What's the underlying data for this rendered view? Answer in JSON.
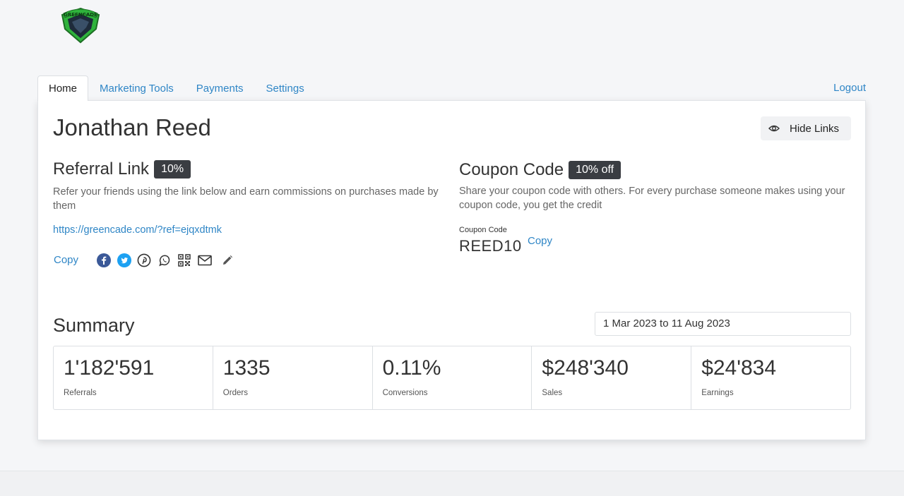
{
  "brand": {
    "logo_text": "GREENCADE",
    "logo_color": "#2fb33c"
  },
  "tabs": [
    {
      "label": "Home",
      "active": true
    },
    {
      "label": "Marketing Tools",
      "active": false
    },
    {
      "label": "Payments",
      "active": false
    },
    {
      "label": "Settings",
      "active": false
    }
  ],
  "logout_label": "Logout",
  "user_name": "Jonathan Reed",
  "hide_links_label": "Hide Links",
  "referral": {
    "title": "Referral Link",
    "badge": "10%",
    "description": "Refer your friends using the link below and earn commissions on purchases made by them",
    "link": "https://greencade.com/?ref=ejqxdtmk",
    "copy_label": "Copy",
    "share_icons": [
      "facebook-icon",
      "twitter-icon",
      "pinterest-icon",
      "whatsapp-icon",
      "qr-code-icon",
      "email-icon",
      "edit-icon"
    ]
  },
  "coupon": {
    "title": "Coupon Code",
    "badge": "10% off",
    "description": "Share your coupon code with others. For every purchase someone makes using your coupon code, you get the credit",
    "field_label": "Coupon Code",
    "code": "REED10",
    "copy_label": "Copy"
  },
  "summary": {
    "title": "Summary",
    "date_range": "1 Mar 2023 to 11 Aug 2023",
    "stats": [
      {
        "value": "1'182'591",
        "label": "Referrals"
      },
      {
        "value": "1335",
        "label": "Orders"
      },
      {
        "value": "0.11%",
        "label": "Conversions"
      },
      {
        "value": "$248'340",
        "label": "Sales"
      },
      {
        "value": "$24'834",
        "label": "Earnings"
      }
    ]
  },
  "colors": {
    "accent": "#2f86c6",
    "badge": "#3a3d42",
    "facebook": "#3b5998",
    "twitter": "#1da1f2"
  }
}
